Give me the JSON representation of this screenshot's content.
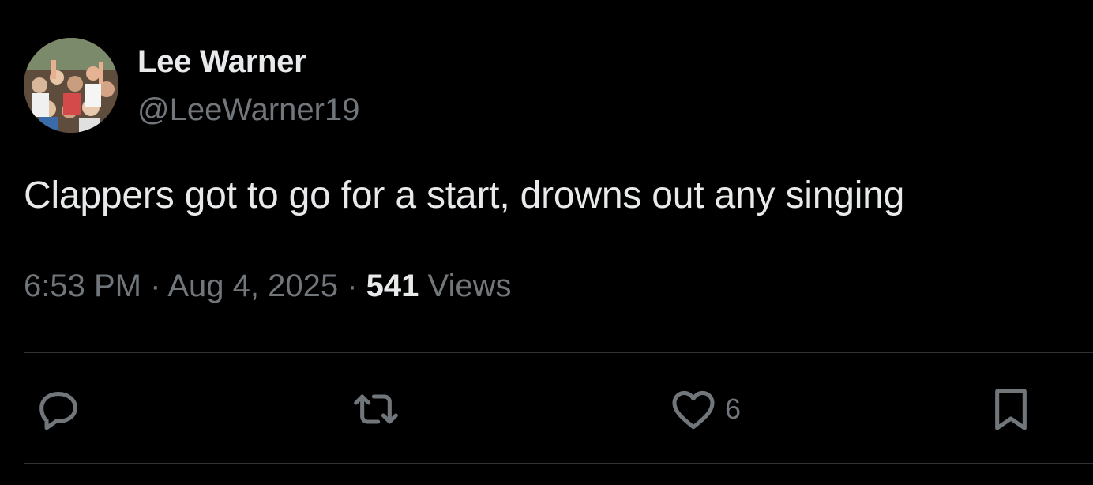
{
  "author": {
    "display_name": "Lee Warner",
    "handle": "@LeeWarner19",
    "avatar_icon": "crowd-photo-avatar"
  },
  "tweet": {
    "text": "Clappers got to go for a start, drowns out any singing",
    "time": "6:53 PM",
    "separator": "·",
    "date": "Aug 4, 2025",
    "views_count": "541",
    "views_label": "Views"
  },
  "actions": {
    "reply": {
      "icon": "reply-icon",
      "count": ""
    },
    "retweet": {
      "icon": "retweet-icon",
      "count": ""
    },
    "like": {
      "icon": "heart-icon",
      "count": "6"
    },
    "bookmark": {
      "icon": "bookmark-icon",
      "count": ""
    }
  },
  "colors": {
    "background": "#000000",
    "primary_text": "#e7e9ea",
    "secondary_text": "#71767b",
    "divider": "#2f3336"
  }
}
